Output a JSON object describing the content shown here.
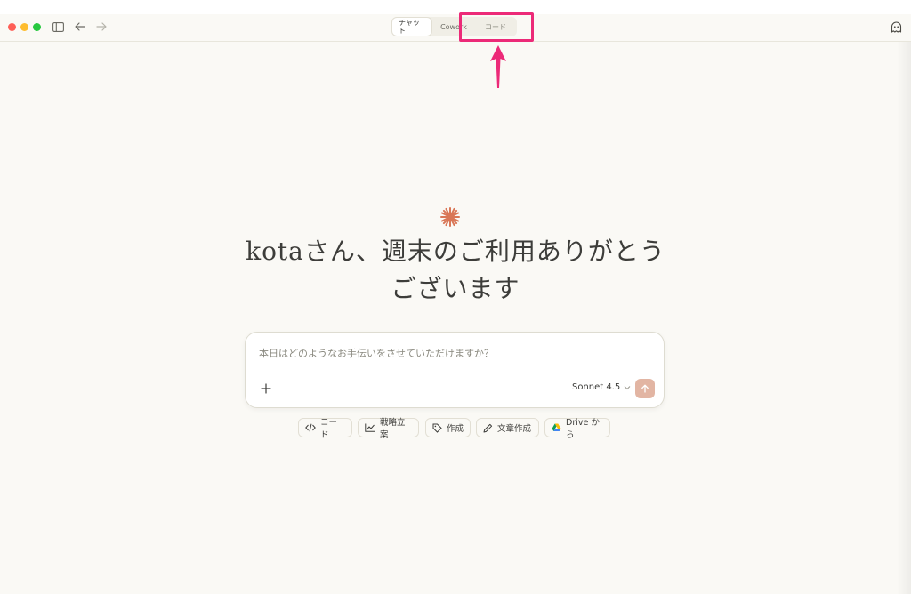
{
  "window": {
    "mode_tabs": [
      {
        "label": "チャット",
        "selected": true
      },
      {
        "label": "Cowork",
        "selected": false
      },
      {
        "label": "コード",
        "selected": false
      }
    ]
  },
  "greeting": {
    "line1": "kotaさん、週末のご利用ありがとう",
    "line2": "ございます"
  },
  "composer": {
    "placeholder": "本日はどのようなお手伝いをさせていただけますか？",
    "model": "Sonnet 4.5"
  },
  "suggestions": [
    {
      "label": "コード",
      "icon": "code-icon"
    },
    {
      "label": "戦略立案",
      "icon": "chart-icon"
    },
    {
      "label": "作成",
      "icon": "tag-icon"
    },
    {
      "label": "文章作成",
      "icon": "pen-icon"
    },
    {
      "label": "Drive から",
      "icon": "google-drive-icon"
    }
  ],
  "colors": {
    "background": "#faf9f5",
    "accent": "#d97757",
    "send_button": "#e2b5a3",
    "highlight": "#ec2a78"
  }
}
